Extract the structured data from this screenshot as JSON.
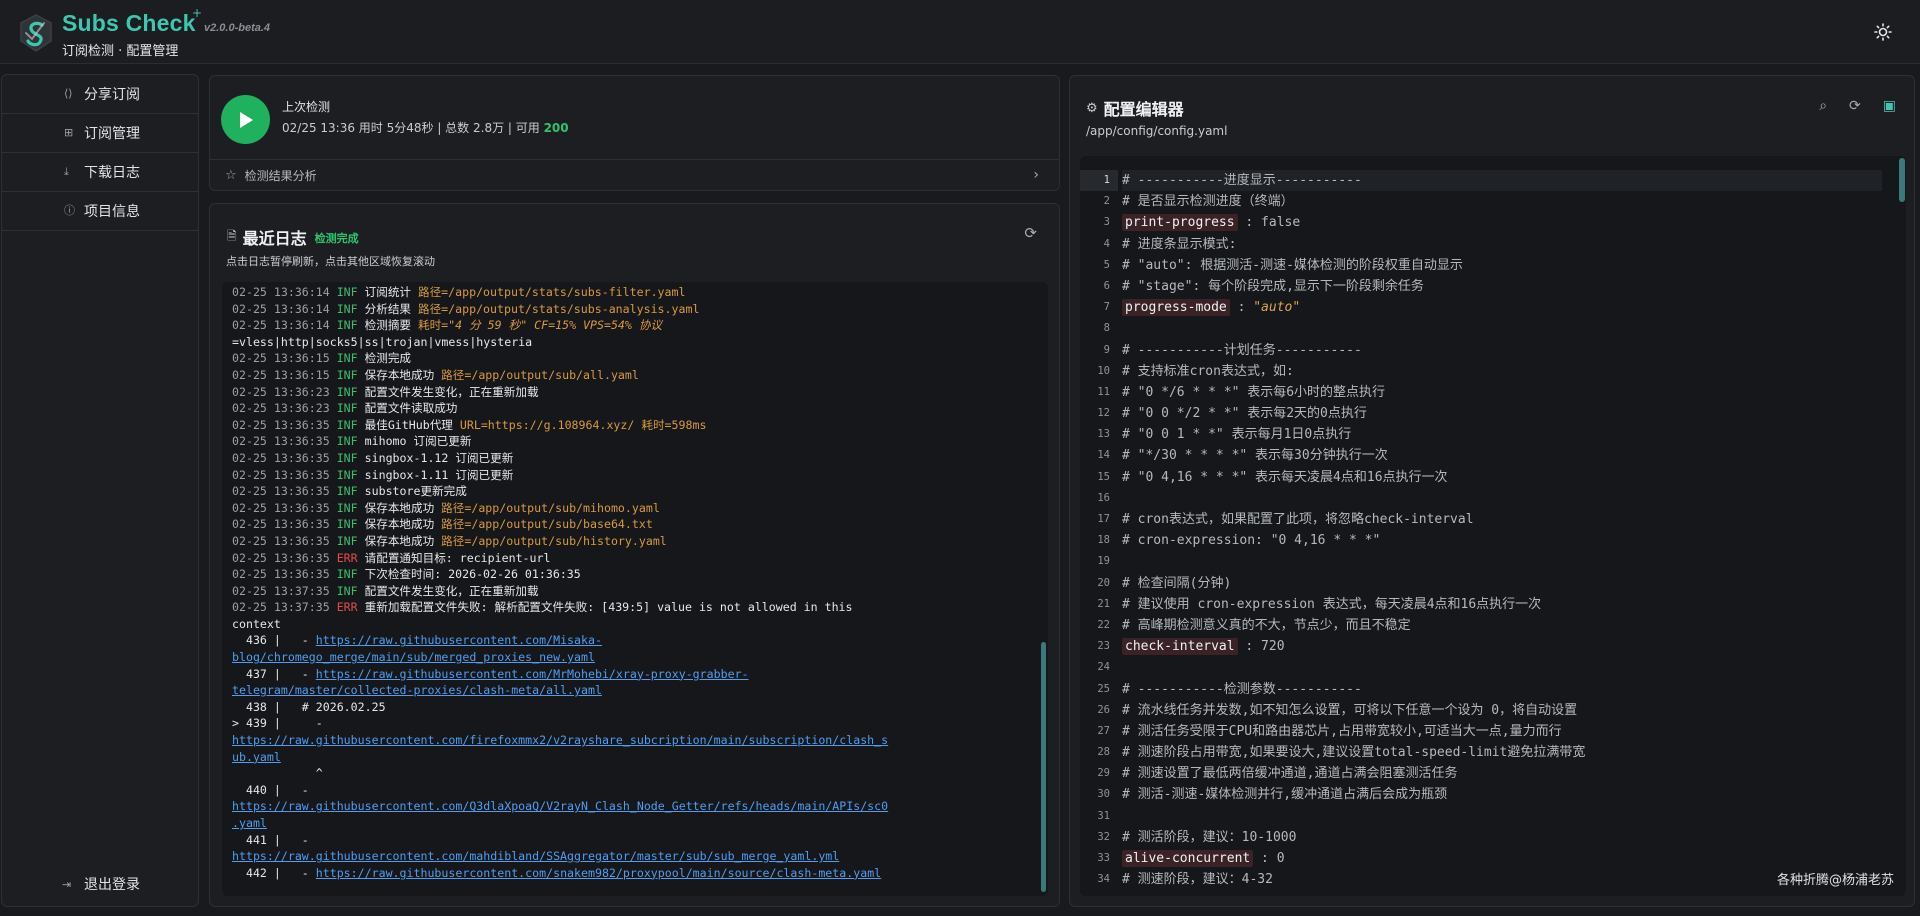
{
  "header": {
    "brand": "Subs Check",
    "brand_plus": "+",
    "version": "v2.0.0-beta.4",
    "subtitle": "订阅检测 · 配置管理",
    "theme_icon": "sun-icon"
  },
  "sidebar": {
    "items": [
      {
        "label": "分享订阅",
        "icon": "share-icon"
      },
      {
        "label": "订阅管理",
        "icon": "grid-icon"
      },
      {
        "label": "下载日志",
        "icon": "download-icon"
      },
      {
        "label": "项目信息",
        "icon": "info-icon"
      }
    ],
    "logout": "退出登录"
  },
  "check": {
    "title": "上次检测",
    "info_prefix": "02/25 13:36 用时 5分48秒 | 总数 2.8万 | 可用 ",
    "available": "200",
    "analysis_label": "检测结果分析"
  },
  "log": {
    "title": "最近日志",
    "status": "检测完成",
    "hint": "点击日志暂停刷新，点击其他区域恢复滚动",
    "lines": [
      {
        "ts": "02-25 13:36:14",
        "lvl": "INF",
        "msg": "订阅统计 ",
        "k": "路径=",
        "v": "/app/output/stats/subs-filter.yaml"
      },
      {
        "ts": "02-25 13:36:14",
        "lvl": "INF",
        "msg": "分析结果 ",
        "k": "路径=",
        "v": "/app/output/stats/subs-analysis.yaml"
      },
      {
        "ts": "02-25 13:36:14",
        "lvl": "INF",
        "msg": "检测摘要 ",
        "k": "耗时=",
        "v": "\"4 分 59 秒\" CF=15% VPS=54% 协议"
      },
      {
        "cont": "=vless|http|socks5|ss|trojan|vmess|hysteria"
      },
      {
        "ts": "02-25 13:36:15",
        "lvl": "INF",
        "msg": "检测完成"
      },
      {
        "ts": "02-25 13:36:15",
        "lvl": "INF",
        "msg": "保存本地成功 ",
        "k": "路径=",
        "v": "/app/output/sub/all.yaml"
      },
      {
        "ts": "02-25 13:36:23",
        "lvl": "INF",
        "msg": "配置文件发生变化，正在重新加载"
      },
      {
        "ts": "02-25 13:36:23",
        "lvl": "INF",
        "msg": "配置文件读取成功"
      },
      {
        "ts": "02-25 13:36:35",
        "lvl": "INF",
        "msg": "最佳GitHub代理 ",
        "k": "URL=",
        "v": "https://g.108964.xyz/",
        "k2": " 耗时=",
        "v2": "598ms"
      },
      {
        "ts": "02-25 13:36:35",
        "lvl": "INF",
        "msg": "mihomo 订阅已更新"
      },
      {
        "ts": "02-25 13:36:35",
        "lvl": "INF",
        "msg": "singbox-1.12 订阅已更新"
      },
      {
        "ts": "02-25 13:36:35",
        "lvl": "INF",
        "msg": "singbox-1.11 订阅已更新"
      },
      {
        "ts": "02-25 13:36:35",
        "lvl": "INF",
        "msg": "substore更新完成"
      },
      {
        "ts": "02-25 13:36:35",
        "lvl": "INF",
        "msg": "保存本地成功 ",
        "k": "路径=",
        "v": "/app/output/sub/mihomo.yaml"
      },
      {
        "ts": "02-25 13:36:35",
        "lvl": "INF",
        "msg": "保存本地成功 ",
        "k": "路径=",
        "v": "/app/output/sub/base64.txt"
      },
      {
        "ts": "02-25 13:36:35",
        "lvl": "INF",
        "msg": "保存本地成功 ",
        "k": "路径=",
        "v": "/app/output/sub/history.yaml"
      },
      {
        "ts": "02-25 13:36:35",
        "lvl": "ERR",
        "msg": "请配置通知目标: recipient-url"
      },
      {
        "ts": "02-25 13:36:35",
        "lvl": "INF",
        "msg": "下次检查时间: 2026-02-26 01:36:35"
      },
      {
        "ts": "02-25 13:37:35",
        "lvl": "INF",
        "msg": "配置文件发生变化，正在重新加载"
      },
      {
        "ts": "02-25 13:37:35",
        "lvl": "ERR",
        "msg": "重新加载配置文件失败: 解析配置文件失败: [439:5] value is not allowed in this"
      },
      {
        "cont": "context"
      },
      {
        "cont": "  436 |   - ",
        "u": "https://raw.githubusercontent.com/Misaka-"
      },
      {
        "cont": "",
        "u": "blog/chromego_merge/main/sub/merged_proxies_new.yaml"
      },
      {
        "cont": "  437 |   - ",
        "u": "https://raw.githubusercontent.com/MrMohebi/xray-proxy-grabber-"
      },
      {
        "cont": "",
        "u": "telegram/master/collected-proxies/clash-meta/all.yaml"
      },
      {
        "cont": "  438 |   # 2026.02.25"
      },
      {
        "cont": "> 439 |     -"
      },
      {
        "cont": "",
        "u": "https://raw.githubusercontent.com/firefoxmmx2/v2rayshare_subcription/main/subscription/clash_s"
      },
      {
        "cont": "",
        "u": "ub.yaml"
      },
      {
        "cont": "            ^"
      },
      {
        "cont": "  440 |   -"
      },
      {
        "cont": "",
        "u": "https://raw.githubusercontent.com/Q3dlaXpoaQ/V2rayN_Clash_Node_Getter/refs/heads/main/APIs/sc0"
      },
      {
        "cont": "",
        "u": ".yaml"
      },
      {
        "cont": "  441 |   -"
      },
      {
        "cont": "",
        "u": "https://raw.githubusercontent.com/mahdibland/SSAggregator/master/sub/sub_merge_yaml.yml"
      },
      {
        "cont": "  442 |   - ",
        "u": "https://raw.githubusercontent.com/snakem982/proxypool/main/source/clash-meta.yaml"
      }
    ]
  },
  "config": {
    "title": "配置编辑器",
    "path": "/app/config/config.yaml",
    "tools": [
      "search-icon",
      "refresh-icon",
      "save-icon"
    ],
    "lines": [
      {
        "t": "# -----------进度显示-----------"
      },
      {
        "t": "# 是否显示检测进度（终端）"
      },
      {
        "key": "print-progress",
        "val": ": false"
      },
      {
        "t": "# 进度条显示模式:"
      },
      {
        "t": "# \"auto\": 根据测活-测速-媒体检测的阶段权重自动显示"
      },
      {
        "t": "# \"stage\": 每个阶段完成,显示下一阶段剩余任务"
      },
      {
        "key": "progress-mode",
        "val": ": ",
        "str": "\"auto\""
      },
      {
        "t": ""
      },
      {
        "t": "# -----------计划任务-----------"
      },
      {
        "t": "# 支持标准cron表达式，如:"
      },
      {
        "t": "# \"0 */6 * * *\" 表示每6小时的整点执行"
      },
      {
        "t": "# \"0 0 */2 * *\" 表示每2天的0点执行"
      },
      {
        "t": "# \"0 0 1 * *\" 表示每月1日0点执行"
      },
      {
        "t": "# \"*/30 * * * *\" 表示每30分钟执行一次"
      },
      {
        "t": "# \"0 4,16 * * *\" 表示每天凌晨4点和16点执行一次"
      },
      {
        "t": ""
      },
      {
        "t": "# cron表达式，如果配置了此项，将忽略check-interval"
      },
      {
        "t": "# cron-expression: \"0 4,16 * * *\""
      },
      {
        "t": ""
      },
      {
        "t": "# 检查间隔(分钟)"
      },
      {
        "t": "# 建议使用 cron-expression 表达式，每天凌晨4点和16点执行一次"
      },
      {
        "t": "# 高峰期检测意义真的不大，节点少，而且不稳定"
      },
      {
        "key": "check-interval",
        "val": ": 720"
      },
      {
        "t": ""
      },
      {
        "t": "# -----------检测参数-----------"
      },
      {
        "t": "# 流水线任务并发数,如不知怎么设置，可将以下任意一个设为 0，将自动设置"
      },
      {
        "t": "# 测活任务受限于CPU和路由器芯片,占用带宽较小,可适当大一点,量力而行"
      },
      {
        "t": "# 测速阶段占用带宽,如果要设大,建议设置total-speed-limit避免拉满带宽"
      },
      {
        "t": "# 测速设置了最低两倍缓冲通道,通道占满会阻塞测活任务"
      },
      {
        "t": "# 测活-测速-媒体检测并行,缓冲通道占满后会成为瓶颈"
      },
      {
        "t": ""
      },
      {
        "t": "# 测活阶段，建议：10-1000"
      },
      {
        "key": "alive-concurrent",
        "val": ": 0"
      },
      {
        "t": "# 测速阶段，建议：4-32"
      }
    ],
    "line_numbers": [
      "1",
      "2",
      "3",
      "4",
      "5",
      "6",
      "7",
      "8",
      "9",
      "10",
      "11",
      "12",
      "13",
      "14",
      "15",
      "16",
      "17",
      "18",
      "19",
      "20",
      "21",
      "22",
      "23",
      "24",
      "25",
      "26",
      "27",
      "28",
      "29",
      "30",
      "31",
      "32",
      "33",
      "34"
    ]
  },
  "watermark": "各种折腾@杨浦老苏"
}
